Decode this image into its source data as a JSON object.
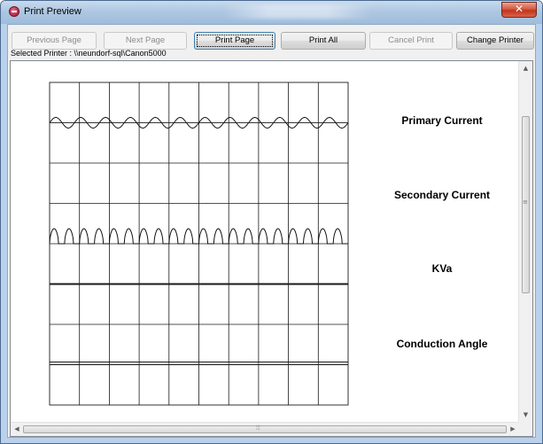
{
  "window": {
    "title": "Print Preview",
    "close_symbol": "✕"
  },
  "toolbar": {
    "buttons": [
      {
        "label": "Previous Page",
        "enabled": false
      },
      {
        "label": "Next Page",
        "enabled": false
      },
      {
        "label": "Print Page",
        "enabled": true,
        "focused": true
      },
      {
        "label": "Print All",
        "enabled": true
      },
      {
        "label": "Cancel Print",
        "enabled": false
      },
      {
        "label": "Change Printer",
        "enabled": true
      }
    ]
  },
  "printer": {
    "selected_text": "Selected Printer : \\\\neundorf-sql\\Canon5000"
  },
  "preview": {
    "traces": [
      {
        "label": "Primary Current",
        "waveform": "small-sine"
      },
      {
        "label": "Secondary Current",
        "waveform": "pulse-train"
      },
      {
        "label": "KVa",
        "waveform": "flat-line"
      },
      {
        "label": "Conduction Angle",
        "waveform": "double-line"
      }
    ],
    "grid": {
      "columns": 10,
      "rows": 8
    },
    "waveform_cycles": {
      "primary": 12,
      "secondary": 20
    }
  },
  "scrollbars": {
    "vertical": {
      "up_icon": "▲",
      "down_icon": "▼",
      "grip": "≡"
    },
    "horizontal": {
      "left_icon": "◀",
      "right_icon": "▶",
      "grip": "⦙⦙⦙"
    }
  }
}
